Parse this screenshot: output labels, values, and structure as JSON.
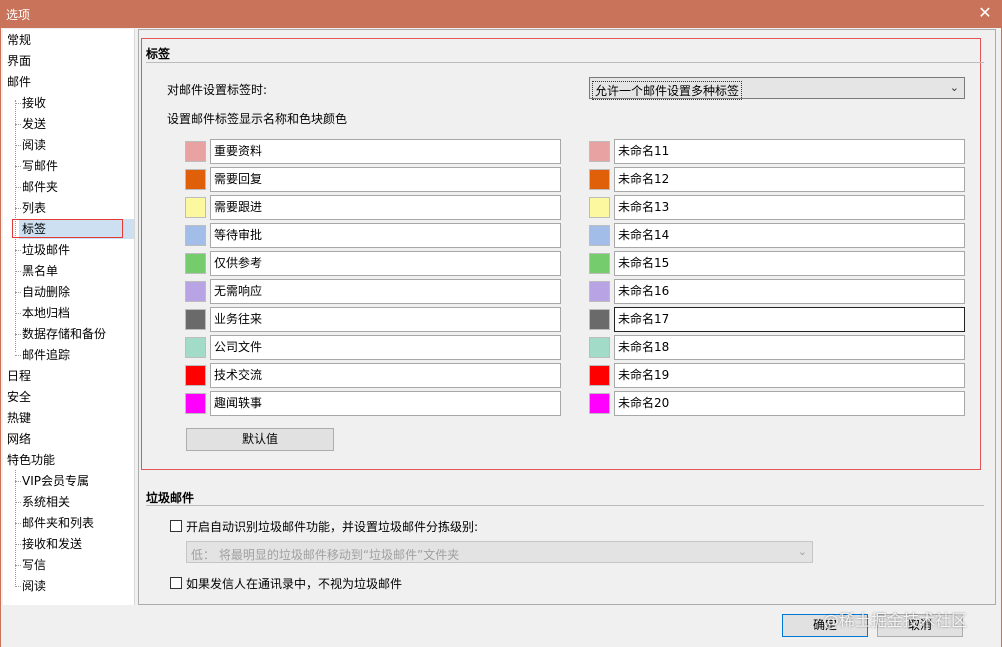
{
  "window": {
    "title": "选项",
    "close_glyph": "✕"
  },
  "sidebar": {
    "top_items": [
      {
        "label": "常规"
      },
      {
        "label": "界面"
      },
      {
        "label": "邮件"
      }
    ],
    "mail_children": [
      {
        "label": "接收"
      },
      {
        "label": "发送"
      },
      {
        "label": "阅读"
      },
      {
        "label": "写邮件"
      },
      {
        "label": "邮件夹"
      },
      {
        "label": "列表"
      },
      {
        "label": "标签"
      },
      {
        "label": "垃圾邮件"
      },
      {
        "label": "黑名单"
      },
      {
        "label": "自动删除"
      },
      {
        "label": "本地归档"
      },
      {
        "label": "数据存储和备份"
      },
      {
        "label": "邮件追踪"
      }
    ],
    "mid_items": [
      {
        "label": "日程"
      },
      {
        "label": "安全"
      },
      {
        "label": "热键"
      },
      {
        "label": "网络"
      },
      {
        "label": "特色功能"
      }
    ],
    "feature_children": [
      {
        "label": "VIP会员专属"
      },
      {
        "label": "系统相关"
      },
      {
        "label": "邮件夹和列表"
      },
      {
        "label": "接收和发送"
      },
      {
        "label": "写信"
      },
      {
        "label": "阅读"
      }
    ],
    "selected": "标签"
  },
  "tags_section": {
    "title": "标签",
    "mode_label": "对邮件设置标签时:",
    "mode_value": "允许一个邮件设置多种标签",
    "display_label": "设置邮件标签显示名称和色块颜色",
    "left_tags": [
      {
        "name": "重要资料",
        "color": "#e8a2a2"
      },
      {
        "name": "需要回复",
        "color": "#e0600a"
      },
      {
        "name": "需要跟进",
        "color": "#fcf8a0"
      },
      {
        "name": "等待审批",
        "color": "#a2bde8"
      },
      {
        "name": "仅供参考",
        "color": "#74cc6c"
      },
      {
        "name": "无需响应",
        "color": "#b8a4e4"
      },
      {
        "name": "业务往来",
        "color": "#6a6a6a"
      },
      {
        "name": "公司文件",
        "color": "#a2dcc8"
      },
      {
        "name": "技术交流",
        "color": "#ff0000"
      },
      {
        "name": "趣闻轶事",
        "color": "#ff00ff"
      }
    ],
    "right_tags": [
      {
        "name": "未命名11",
        "color": "#e8a2a2"
      },
      {
        "name": "未命名12",
        "color": "#e0600a"
      },
      {
        "name": "未命名13",
        "color": "#fcf8a0"
      },
      {
        "name": "未命名14",
        "color": "#a2bde8"
      },
      {
        "name": "未命名15",
        "color": "#74cc6c"
      },
      {
        "name": "未命名16",
        "color": "#b8a4e4"
      },
      {
        "name": "未命名17",
        "color": "#6a6a6a"
      },
      {
        "name": "未命名18",
        "color": "#a2dcc8"
      },
      {
        "name": "未命名19",
        "color": "#ff0000"
      },
      {
        "name": "未命名20",
        "color": "#ff00ff"
      }
    ],
    "default_button": "默认值"
  },
  "spam_section": {
    "title": "垃圾邮件",
    "auto_detect_label": "开启自动识别垃圾邮件功能，并设置垃圾邮件分拣级别:",
    "level_value": "低：  将最明显的垃圾邮件移动到“垃圾邮件”文件夹",
    "contacts_label": "如果发信人在通讯录中，不视为垃圾邮件"
  },
  "footer": {
    "ok": "确定",
    "cancel": "取消"
  },
  "watermark": "@稀土掘金技术社区"
}
